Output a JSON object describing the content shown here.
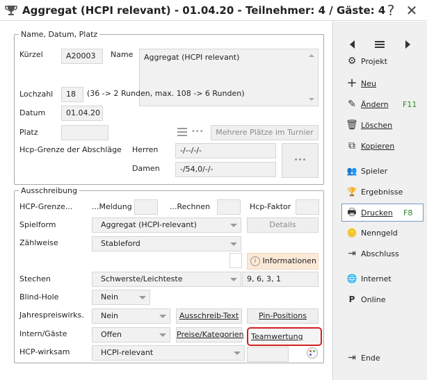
{
  "window": {
    "title": "Aggregat (HCPI relevant) - 01.04.20 - Teilnehmer: 4 / Gäste: 4",
    "help_label": "?",
    "close_label": "✕"
  },
  "group1": {
    "legend": "Name, Datum, Platz",
    "kuerzel_label": "Kürzel",
    "kuerzel_value": "A20003",
    "name_label": "Name",
    "name_value": "Aggregat (HCPI relevant)",
    "lochzahl_label": "Lochzahl",
    "lochzahl_value": "18",
    "lochzahl_hint": "(36 -> 2 Runden, max. 108 -> 6 Runden)",
    "datum_label": "Datum",
    "datum_value": "01.04.20",
    "platz_label": "Platz",
    "platz_value": "",
    "mehrere_label": "Mehrere Plätze im Turnier",
    "hcp_grenze_label": "Hcp-Grenze der Abschläge",
    "herren_label": "Herren",
    "herren_value": "-/--/-/-",
    "damen_label": "Damen",
    "damen_value": "-/54,0/-/-",
    "more_label": "•••"
  },
  "group2": {
    "legend": "Ausschreibung",
    "hcp_grenze_label": "HCP-Grenze...",
    "meldung_label": "...Meldung",
    "rechnen_label": "...Rechnen",
    "hcp_faktor_label": "Hcp-Faktor",
    "spielform_label": "Spielform",
    "spielform_value": "Aggregat (HCPI-relevant)",
    "details_label": "Details",
    "zaehlweise_label": "Zählweise",
    "zaehlweise_value": "Stableford",
    "informationen_label": "Informationen",
    "stechen_label": "Stechen",
    "stechen_value": "Schwerste/Leichteste",
    "stechen_holes": "9, 6, 3, 1",
    "blind_label": "Blind-Hole",
    "blind_value": "Nein",
    "jahres_label": "Jahrespreiswirks.",
    "jahres_value": "Nein",
    "ausschreib_label": "Ausschreib-Text",
    "pin_label": "Pin-Positions",
    "intern_label": "Intern/Gäste",
    "intern_value": "Offen",
    "preise_label": "Preise/Kategorien",
    "team_label": "Teamwertung",
    "hcpw_label": "HCP-wirksam",
    "hcpw_value": "HCPI-relevant"
  },
  "sidebar": {
    "items": [
      {
        "icon": "gear-icon",
        "glyph": "⚙",
        "label": "Projekt"
      },
      {
        "icon": "plus-icon",
        "glyph": "+",
        "label": "Neu"
      },
      {
        "icon": "pencil-icon",
        "glyph": "✎",
        "label": "Ändern",
        "shortcut": "F11"
      },
      {
        "icon": "trash-icon",
        "glyph": "🗑",
        "label": "Löschen"
      },
      {
        "icon": "copy-icon",
        "glyph": "⧉",
        "label": "Kopieren"
      },
      {
        "icon": "users-icon",
        "glyph": "👥",
        "label": "Spieler"
      },
      {
        "icon": "trophy-icon",
        "glyph": "🏆",
        "label": "Ergebnisse"
      },
      {
        "icon": "printer-icon",
        "glyph": "🖶",
        "label": "Drucken",
        "shortcut": "F8"
      },
      {
        "icon": "coins-icon",
        "glyph": "🪙",
        "label": "Nenngeld"
      },
      {
        "icon": "exit-arrow-icon",
        "glyph": "⇥",
        "label": "Abschluss"
      },
      {
        "icon": "globe-icon",
        "glyph": "🌐",
        "label": "Internet"
      },
      {
        "icon": "pio-icon",
        "glyph": "P",
        "label": "Online"
      },
      {
        "icon": "logout-icon",
        "glyph": "⇥",
        "label": "Ende"
      }
    ]
  },
  "colors": {
    "highlight_border": "#d42020",
    "info_bg": "#fbe9d8",
    "shortcut": "#2a8a2a",
    "selected_border": "#7a9ac2"
  }
}
